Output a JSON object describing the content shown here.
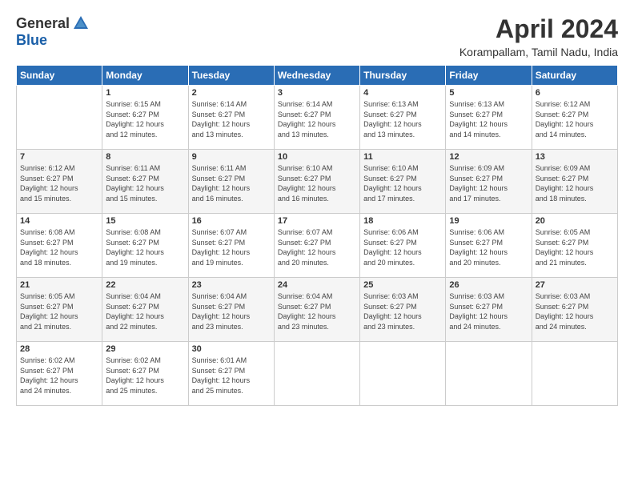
{
  "logo": {
    "general": "General",
    "blue": "Blue"
  },
  "title": "April 2024",
  "location": "Korampallam, Tamil Nadu, India",
  "days_of_week": [
    "Sunday",
    "Monday",
    "Tuesday",
    "Wednesday",
    "Thursday",
    "Friday",
    "Saturday"
  ],
  "weeks": [
    [
      {
        "day": "",
        "info": ""
      },
      {
        "day": "1",
        "info": "Sunrise: 6:15 AM\nSunset: 6:27 PM\nDaylight: 12 hours\nand 12 minutes."
      },
      {
        "day": "2",
        "info": "Sunrise: 6:14 AM\nSunset: 6:27 PM\nDaylight: 12 hours\nand 13 minutes."
      },
      {
        "day": "3",
        "info": "Sunrise: 6:14 AM\nSunset: 6:27 PM\nDaylight: 12 hours\nand 13 minutes."
      },
      {
        "day": "4",
        "info": "Sunrise: 6:13 AM\nSunset: 6:27 PM\nDaylight: 12 hours\nand 13 minutes."
      },
      {
        "day": "5",
        "info": "Sunrise: 6:13 AM\nSunset: 6:27 PM\nDaylight: 12 hours\nand 14 minutes."
      },
      {
        "day": "6",
        "info": "Sunrise: 6:12 AM\nSunset: 6:27 PM\nDaylight: 12 hours\nand 14 minutes."
      }
    ],
    [
      {
        "day": "7",
        "info": "Sunrise: 6:12 AM\nSunset: 6:27 PM\nDaylight: 12 hours\nand 15 minutes."
      },
      {
        "day": "8",
        "info": "Sunrise: 6:11 AM\nSunset: 6:27 PM\nDaylight: 12 hours\nand 15 minutes."
      },
      {
        "day": "9",
        "info": "Sunrise: 6:11 AM\nSunset: 6:27 PM\nDaylight: 12 hours\nand 16 minutes."
      },
      {
        "day": "10",
        "info": "Sunrise: 6:10 AM\nSunset: 6:27 PM\nDaylight: 12 hours\nand 16 minutes."
      },
      {
        "day": "11",
        "info": "Sunrise: 6:10 AM\nSunset: 6:27 PM\nDaylight: 12 hours\nand 17 minutes."
      },
      {
        "day": "12",
        "info": "Sunrise: 6:09 AM\nSunset: 6:27 PM\nDaylight: 12 hours\nand 17 minutes."
      },
      {
        "day": "13",
        "info": "Sunrise: 6:09 AM\nSunset: 6:27 PM\nDaylight: 12 hours\nand 18 minutes."
      }
    ],
    [
      {
        "day": "14",
        "info": "Sunrise: 6:08 AM\nSunset: 6:27 PM\nDaylight: 12 hours\nand 18 minutes."
      },
      {
        "day": "15",
        "info": "Sunrise: 6:08 AM\nSunset: 6:27 PM\nDaylight: 12 hours\nand 19 minutes."
      },
      {
        "day": "16",
        "info": "Sunrise: 6:07 AM\nSunset: 6:27 PM\nDaylight: 12 hours\nand 19 minutes."
      },
      {
        "day": "17",
        "info": "Sunrise: 6:07 AM\nSunset: 6:27 PM\nDaylight: 12 hours\nand 20 minutes."
      },
      {
        "day": "18",
        "info": "Sunrise: 6:06 AM\nSunset: 6:27 PM\nDaylight: 12 hours\nand 20 minutes."
      },
      {
        "day": "19",
        "info": "Sunrise: 6:06 AM\nSunset: 6:27 PM\nDaylight: 12 hours\nand 20 minutes."
      },
      {
        "day": "20",
        "info": "Sunrise: 6:05 AM\nSunset: 6:27 PM\nDaylight: 12 hours\nand 21 minutes."
      }
    ],
    [
      {
        "day": "21",
        "info": "Sunrise: 6:05 AM\nSunset: 6:27 PM\nDaylight: 12 hours\nand 21 minutes."
      },
      {
        "day": "22",
        "info": "Sunrise: 6:04 AM\nSunset: 6:27 PM\nDaylight: 12 hours\nand 22 minutes."
      },
      {
        "day": "23",
        "info": "Sunrise: 6:04 AM\nSunset: 6:27 PM\nDaylight: 12 hours\nand 23 minutes."
      },
      {
        "day": "24",
        "info": "Sunrise: 6:04 AM\nSunset: 6:27 PM\nDaylight: 12 hours\nand 23 minutes."
      },
      {
        "day": "25",
        "info": "Sunrise: 6:03 AM\nSunset: 6:27 PM\nDaylight: 12 hours\nand 23 minutes."
      },
      {
        "day": "26",
        "info": "Sunrise: 6:03 AM\nSunset: 6:27 PM\nDaylight: 12 hours\nand 24 minutes."
      },
      {
        "day": "27",
        "info": "Sunrise: 6:03 AM\nSunset: 6:27 PM\nDaylight: 12 hours\nand 24 minutes."
      }
    ],
    [
      {
        "day": "28",
        "info": "Sunrise: 6:02 AM\nSunset: 6:27 PM\nDaylight: 12 hours\nand 24 minutes."
      },
      {
        "day": "29",
        "info": "Sunrise: 6:02 AM\nSunset: 6:27 PM\nDaylight: 12 hours\nand 25 minutes."
      },
      {
        "day": "30",
        "info": "Sunrise: 6:01 AM\nSunset: 6:27 PM\nDaylight: 12 hours\nand 25 minutes."
      },
      {
        "day": "",
        "info": ""
      },
      {
        "day": "",
        "info": ""
      },
      {
        "day": "",
        "info": ""
      },
      {
        "day": "",
        "info": ""
      }
    ]
  ]
}
